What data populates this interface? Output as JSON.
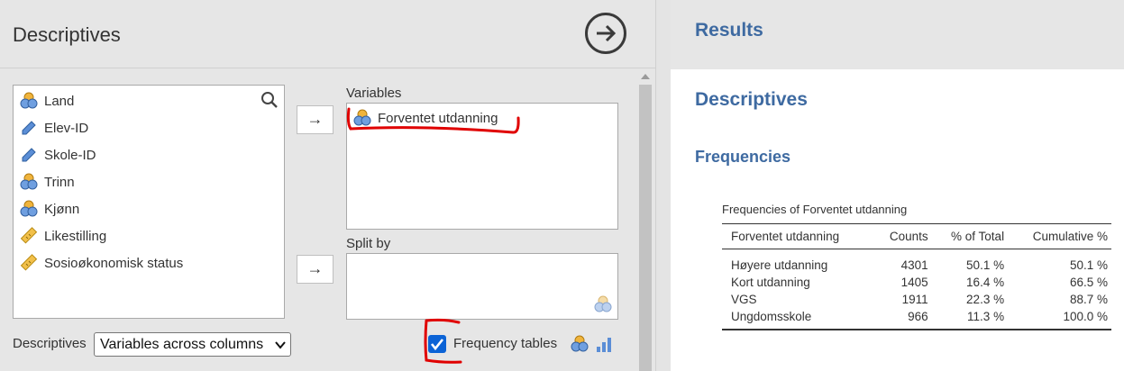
{
  "analysis_panel": {
    "title": "Descriptives",
    "run_icon": "arrow-right-circle-icon",
    "variable_list": [
      {
        "label": "Land",
        "icon": "nominal-icon"
      },
      {
        "label": "Elev-ID",
        "icon": "id-icon"
      },
      {
        "label": "Skole-ID",
        "icon": "id-icon"
      },
      {
        "label": "Trinn",
        "icon": "nominal-icon"
      },
      {
        "label": "Kjønn",
        "icon": "nominal-icon"
      },
      {
        "label": "Likestilling",
        "icon": "continuous-icon"
      },
      {
        "label": "Sosioøkonomisk status",
        "icon": "continuous-icon"
      }
    ],
    "move_button_label": "→",
    "variables_label": "Variables",
    "variables": [
      {
        "label": "Forventet utdanning",
        "icon": "nominal-icon"
      }
    ],
    "split_by_label": "Split by",
    "descriptives_label": "Descriptives",
    "descriptives_select_value": "Variables across columns",
    "frequency_tables_label": "Frequency tables",
    "frequency_tables_checked": true,
    "colors": {
      "accent": "#0b63d6",
      "annotation": "#e00000"
    }
  },
  "results": {
    "header": "Results",
    "heading": "Descriptives",
    "subheading": "Frequencies",
    "table_title": "Frequencies of Forventet utdanning",
    "columns": [
      "Forventet utdanning",
      "Counts",
      "% of Total",
      "Cumulative %"
    ],
    "rows": [
      [
        "Høyere utdanning",
        "4301",
        "50.1 %",
        "50.1 %"
      ],
      [
        "Kort utdanning",
        "1405",
        "16.4 %",
        "66.5 %"
      ],
      [
        "VGS",
        "1911",
        "22.3 %",
        "88.7 %"
      ],
      [
        "Ungdomsskole",
        "966",
        "11.3 %",
        "100.0 %"
      ]
    ],
    "colors": {
      "heading": "#3e6aa1"
    }
  }
}
